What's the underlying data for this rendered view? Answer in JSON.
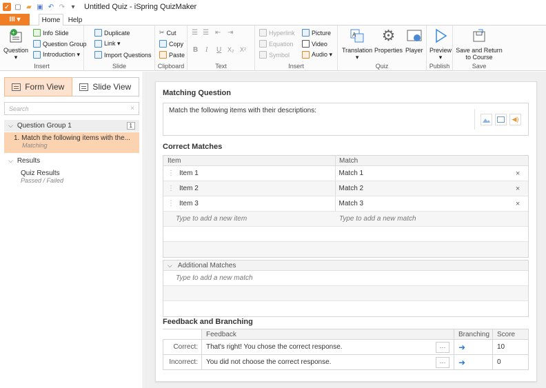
{
  "titlebar": {
    "title": "Untitled Quiz - iSpring QuizMaker"
  },
  "tabs": {
    "file_label": "III ▾",
    "home": "Home",
    "help": "Help"
  },
  "ribbon": {
    "insert_group": {
      "question": "Question",
      "info_slide": "Info Slide",
      "question_group": "Question Group",
      "introduction": "Introduction ▾",
      "label": "Insert"
    },
    "slide_group": {
      "duplicate": "Duplicate",
      "link": "Link ▾",
      "import_questions": "Import Questions",
      "label": "Slide"
    },
    "clipboard_group": {
      "cut": "Cut",
      "copy": "Copy",
      "paste": "Paste",
      "label": "Clipboard"
    },
    "text_group": {
      "label": "Text"
    },
    "insert2_group": {
      "hyperlink": "Hyperlink",
      "equation": "Equation",
      "symbol": "Symbol",
      "picture": "Picture",
      "video": "Video",
      "audio": "Audio ▾",
      "label": "Insert"
    },
    "quiz_group": {
      "translation": "Translation",
      "properties": "Properties",
      "player": "Player",
      "label": "Quiz"
    },
    "publish_group": {
      "preview": "Preview",
      "label": "Publish"
    },
    "save_group": {
      "save_return": "Save and Return to Course",
      "label": "Save"
    }
  },
  "left": {
    "form_view": "Form View",
    "slide_view": "Slide View",
    "search_placeholder": "Search",
    "group_name": "Question Group 1",
    "group_count": "1",
    "item_title": "1. Match the following items with the...",
    "item_type": "Matching",
    "results_label": "Results",
    "quiz_results": "Quiz Results",
    "quiz_results_sub": "Passed / Failed"
  },
  "main": {
    "matching_question_heading": "Matching Question",
    "question_text": "Match the following items with their descriptions:",
    "correct_matches_heading": "Correct Matches",
    "col_item": "Item",
    "col_match": "Match",
    "rows": [
      {
        "item": "Item 1",
        "match": "Match 1"
      },
      {
        "item": "Item 2",
        "match": "Match 2"
      },
      {
        "item": "Item 3",
        "match": "Match 3"
      }
    ],
    "new_item_placeholder": "Type to add a new item",
    "new_match_placeholder": "Type to add a new match",
    "additional_matches": "Additional Matches",
    "additional_placeholder": "Type to add a new match",
    "feedback_heading": "Feedback and Branching",
    "fb_col_feedback": "Feedback",
    "fb_col_branching": "Branching",
    "fb_col_score": "Score",
    "correct_label": "Correct:",
    "correct_text": "That's right! You chose the correct response.",
    "correct_score": "10",
    "incorrect_label": "Incorrect:",
    "incorrect_text": "You did not choose the correct response.",
    "incorrect_score": "0"
  }
}
